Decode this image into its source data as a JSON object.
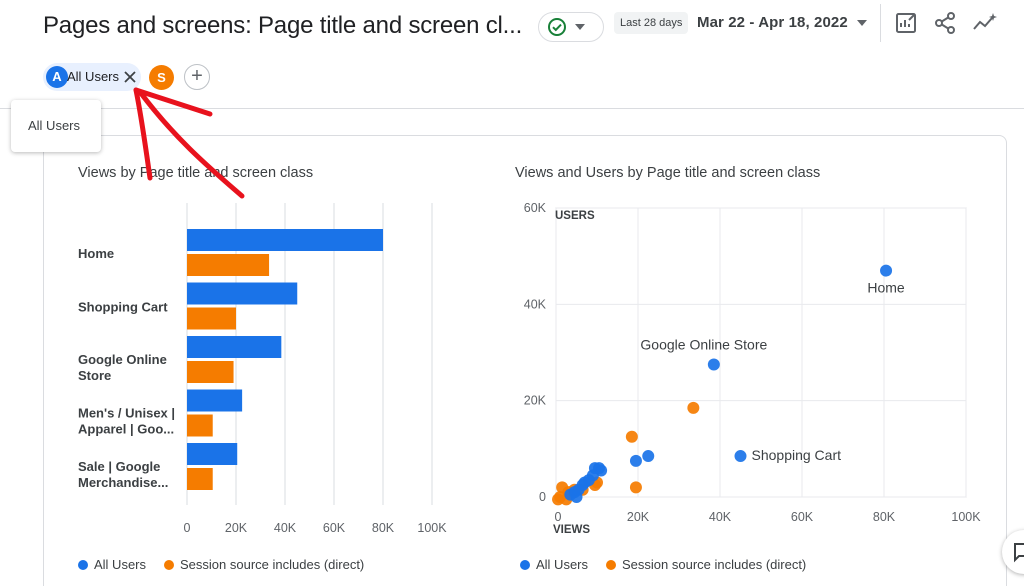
{
  "header": {
    "title": "Pages and screens: Page title and screen cl...",
    "date_chip": "Last 28 days",
    "date_range": "Mar 22 - Apr 18, 2022"
  },
  "comparison": {
    "segment_a": {
      "initial": "A",
      "label": "All Users"
    },
    "segment_b": {
      "initial": "S"
    },
    "add_label": "+"
  },
  "tooltip": {
    "text": "All Users"
  },
  "colors": {
    "all_users": "#1a73e8",
    "direct": "#f57c00",
    "annotation": "#e8121d"
  },
  "icons": [
    "check-circle-icon",
    "chevron-down-icon",
    "customize-report-icon",
    "share-icon",
    "insights-icon",
    "close-icon",
    "add-icon",
    "feedback-icon"
  ],
  "bar_chart": {
    "title": "Views by Page title and screen class",
    "legend": [
      "All Users",
      "Session source includes (direct)"
    ]
  },
  "scatter_chart": {
    "title": "Views and Users by Page title and screen class",
    "legend": [
      "All Users",
      "Session source includes (direct)"
    ]
  },
  "chart_data": [
    {
      "type": "bar",
      "orientation": "horizontal",
      "title": "Views by Page title and screen class",
      "categories": [
        "Home",
        "Shopping Cart",
        "Google Online Store",
        "Men's / Unisex | Apparel | Goo...",
        "Sale | Google Merchandise..."
      ],
      "category_lines": [
        [
          "Home"
        ],
        [
          "Shopping Cart"
        ],
        [
          "Google Online",
          "Store"
        ],
        [
          "Men's / Unisex |",
          "Apparel | Goo..."
        ],
        [
          "Sale | Google",
          "Merchandise..."
        ]
      ],
      "series": [
        {
          "name": "All Users",
          "values": [
            80000,
            45000,
            38500,
            22500,
            20500
          ]
        },
        {
          "name": "Session source includes (direct)",
          "values": [
            33500,
            20000,
            19000,
            10500,
            10500
          ]
        }
      ],
      "xticks": [
        "0",
        "20K",
        "40K",
        "60K",
        "80K",
        "100K"
      ],
      "xlim": [
        0,
        100000
      ],
      "grid": true,
      "legend_position": "bottom"
    },
    {
      "type": "scatter",
      "title": "Views and Users by Page title and screen class",
      "xlabel": "VIEWS",
      "ylabel": "USERS",
      "xticks": [
        "0",
        "20K",
        "40K",
        "60K",
        "80K",
        "100K"
      ],
      "yticks": [
        "0",
        "20K",
        "40K",
        "60K"
      ],
      "xlim": [
        0,
        100000
      ],
      "ylim": [
        0,
        60000
      ],
      "grid": true,
      "legend_position": "bottom",
      "series": [
        {
          "name": "All Users",
          "points": [
            {
              "x": 80500,
              "y": 47000,
              "label": "Home"
            },
            {
              "x": 38500,
              "y": 27500,
              "label": "Google Online Store"
            },
            {
              "x": 45000,
              "y": 8500,
              "label": "Shopping Cart"
            },
            {
              "x": 22500,
              "y": 8500
            },
            {
              "x": 19500,
              "y": 7500
            },
            {
              "x": 11000,
              "y": 5500
            },
            {
              "x": 9500,
              "y": 6000
            },
            {
              "x": 10500,
              "y": 6000
            },
            {
              "x": 9000,
              "y": 4500
            },
            {
              "x": 8000,
              "y": 3500
            },
            {
              "x": 7000,
              "y": 3000
            },
            {
              "x": 6500,
              "y": 2500
            },
            {
              "x": 5500,
              "y": 1500
            },
            {
              "x": 5000,
              "y": 0
            },
            {
              "x": 4500,
              "y": 1000
            },
            {
              "x": 3500,
              "y": 500
            }
          ]
        },
        {
          "name": "Session source includes (direct)",
          "points": [
            {
              "x": 33500,
              "y": 18500
            },
            {
              "x": 18500,
              "y": 12500
            },
            {
              "x": 19500,
              "y": 2000
            },
            {
              "x": 10000,
              "y": 3000
            },
            {
              "x": 9500,
              "y": 2500
            },
            {
              "x": 6500,
              "y": 1500
            },
            {
              "x": 4500,
              "y": 1500
            },
            {
              "x": 3000,
              "y": 1000
            },
            {
              "x": 1500,
              "y": 2000
            },
            {
              "x": 1000,
              "y": 0
            },
            {
              "x": 500,
              "y": -500
            },
            {
              "x": 2500,
              "y": -500
            }
          ]
        }
      ]
    }
  ]
}
